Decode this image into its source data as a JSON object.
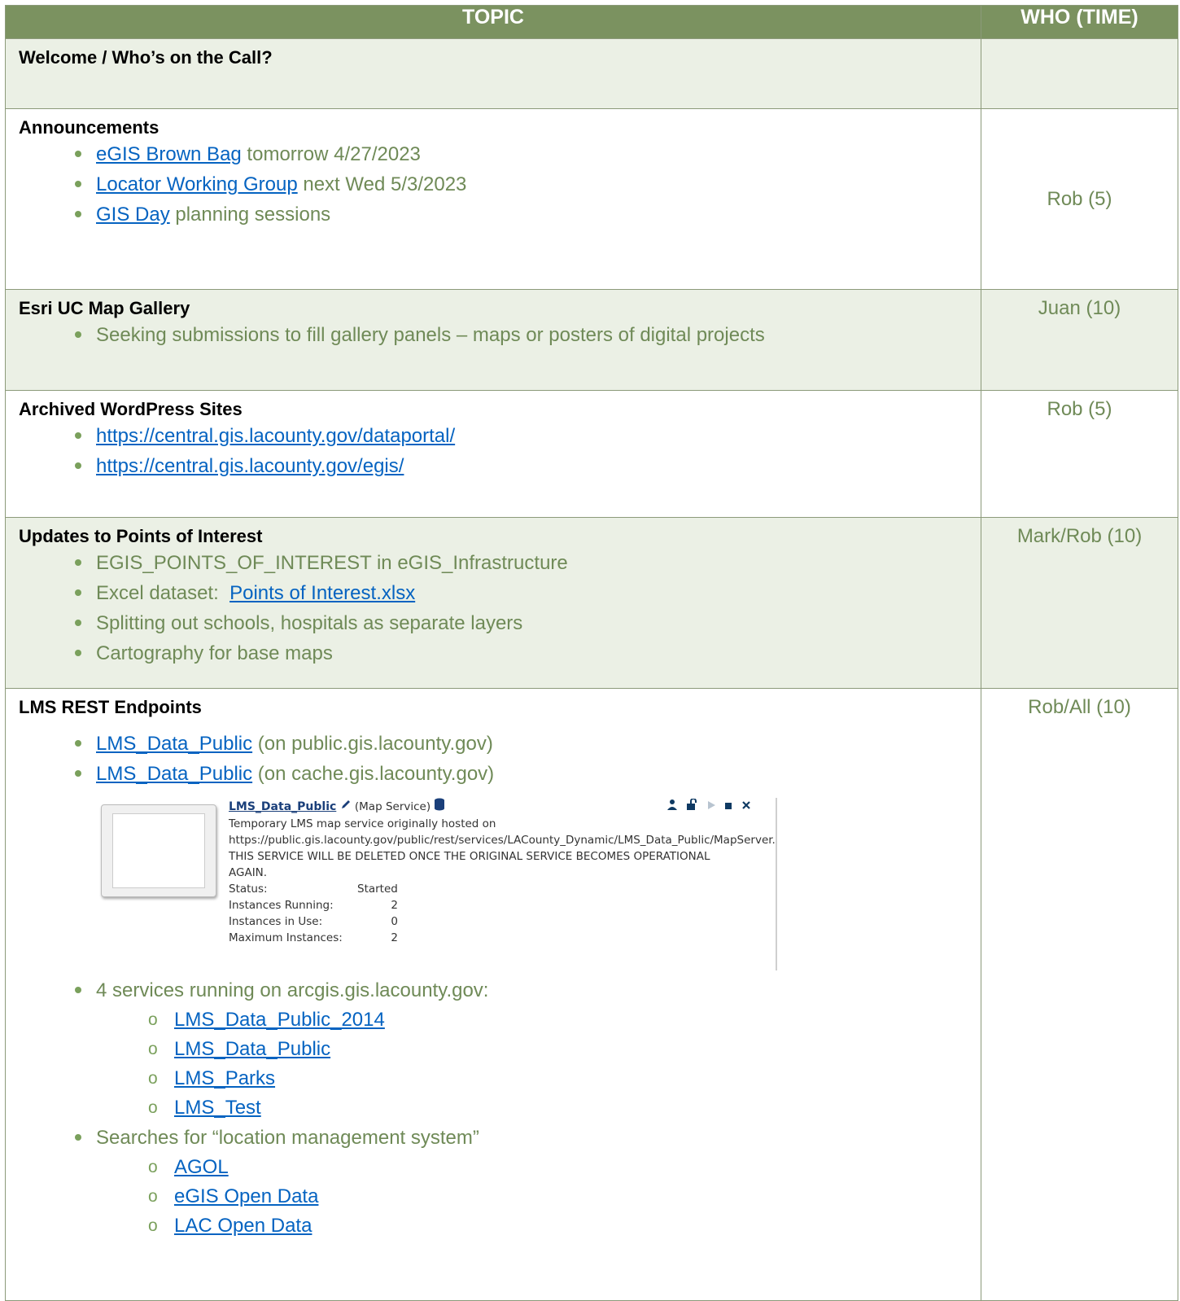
{
  "header": {
    "topic": "TOPIC",
    "who": "WHO (TIME)"
  },
  "rows": {
    "welcome": {
      "title": "Welcome / Who’s on the Call?",
      "who": ""
    },
    "announcements": {
      "title": "Announcements",
      "items": [
        {
          "link": "eGIS Brown Bag",
          "text": " tomorrow 4/27/2023"
        },
        {
          "link": "Locator Working Group",
          "text": " next Wed 5/3/2023"
        },
        {
          "link": "GIS Day",
          "text": " planning sessions"
        }
      ],
      "who": "Rob (5)"
    },
    "esri": {
      "title": "Esri UC Map Gallery",
      "items": [
        "Seeking submissions to fill gallery panels – maps or posters of digital projects"
      ],
      "who": "Juan (10)"
    },
    "wordpress": {
      "title": "Archived WordPress Sites",
      "links": [
        "https://central.gis.lacounty.gov/dataportal/",
        "https://central.gis.lacounty.gov/egis/"
      ],
      "who": "Rob (5)"
    },
    "poi": {
      "title": "Updates to Points of Interest",
      "item1": "EGIS_POINTS_OF_INTEREST in eGIS_Infrastructure",
      "item2_prefix": "Excel dataset:  ",
      "item2_link": "Points of Interest.xlsx",
      "item3": "Splitting out schools, hospitals as separate layers",
      "item4": "Cartography for base maps",
      "who": "Mark/Rob (10)"
    },
    "lms": {
      "title": "LMS REST Endpoints",
      "endpoint1_link": "LMS_Data_Public",
      "endpoint1_text": " (on public.gis.lacounty.gov)",
      "endpoint2_link": "LMS_Data_Public",
      "endpoint2_text": " (on cache.gis.lacounty.gov)",
      "service_card": {
        "name": "LMS_Data_Public",
        "type": " (Map Service)",
        "desc1": "Temporary LMS map service originally hosted on",
        "desc2": "https://public.gis.lacounty.gov/public/rest/services/LACounty_Dynamic/LMS_Data_Public/MapServer.",
        "desc3": "THIS SERVICE WILL BE DELETED ONCE THE ORIGINAL SERVICE BECOMES OPERATIONAL",
        "desc4": "AGAIN.",
        "status_label": "Status:",
        "status_value": "Started",
        "running_label": "Instances Running:",
        "running_value": "2",
        "inuse_label": "Instances in Use:",
        "inuse_value": "0",
        "max_label": "Maximum Instances:",
        "max_value": "2"
      },
      "services_heading": "4 services running on arcgis.gis.lacounty.gov:",
      "services": [
        "LMS_Data_Public_2014",
        "LMS_Data_Public",
        "LMS_Parks",
        "LMS_Test"
      ],
      "searches_heading": "Searches for “location management system”",
      "searches": [
        "AGOL",
        "eGIS Open Data",
        "LAC Open Data"
      ],
      "who": "Rob/All (10)"
    }
  },
  "colors": {
    "header_bg": "#7b9260",
    "shade_bg": "#ebf0e5",
    "link": "#0563c1",
    "body_text": "#6f8a57"
  }
}
